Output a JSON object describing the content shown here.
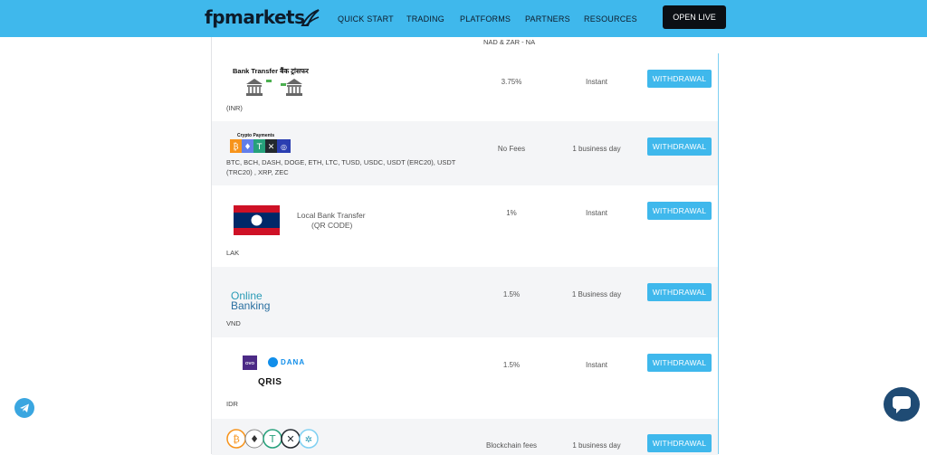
{
  "header": {
    "logo": "fpmarkets",
    "nav": [
      {
        "label": "QUICK START"
      },
      {
        "label": "TRADING"
      },
      {
        "label": "PLATFORMS"
      },
      {
        "label": "PARTNERS"
      },
      {
        "label": "RESOURCES"
      }
    ],
    "cta": "OPEN LIVE"
  },
  "top_note": "NAD & ZAR - NA",
  "rows": [
    {
      "logo_title": "Bank Transfer बैंक ट्रांसफर",
      "currency": "(INR)",
      "fee": "3.75%",
      "time": "Instant",
      "button": "WITHDRAWAL"
    },
    {
      "logo_title": "Crypto Payments",
      "currency": "BTC, BCH, DASH, DOGE, ETH, LTC, TUSD, USDC, USDT (ERC20), USDT (TRC20) , XRP, ZEC",
      "fee": "No Fees",
      "time": "1 business day",
      "button": "WITHDRAWAL"
    },
    {
      "logo_title": "Local Bank Transfer",
      "logo_subtitle": "(QR CODE)",
      "currency": "LAK",
      "fee": "1%",
      "time": "Instant",
      "button": "WITHDRAWAL"
    },
    {
      "logo_title": "Online",
      "logo_subtitle": "Banking",
      "currency": "VND",
      "fee": "1.5%",
      "time": "1 Business day",
      "button": "WITHDRAWAL"
    },
    {
      "logo_ovo": "OVO",
      "logo_dana": "DANA",
      "logo_qris": "QRIS",
      "currency": "IDR",
      "fee": "1.5%",
      "time": "Instant",
      "button": "WITHDRAWAL"
    },
    {
      "fee": "Blockchain fees",
      "time": "1 business day",
      "button": "WITHDRAWAL"
    }
  ],
  "colors": {
    "header_bg": "#3fb8ec",
    "button_bg": "#3fb8ec",
    "cta_bg": "#0b0f14",
    "row_alt_bg": "#f4f5f7",
    "chat_bg": "#1f4b74"
  },
  "icons": [
    "telegram-icon",
    "chat-icon",
    "bank-icon",
    "bitcoin-icon",
    "ethereum-icon",
    "tether-icon",
    "xrp-icon",
    "usdc-icon",
    "laos-flag-icon"
  ]
}
